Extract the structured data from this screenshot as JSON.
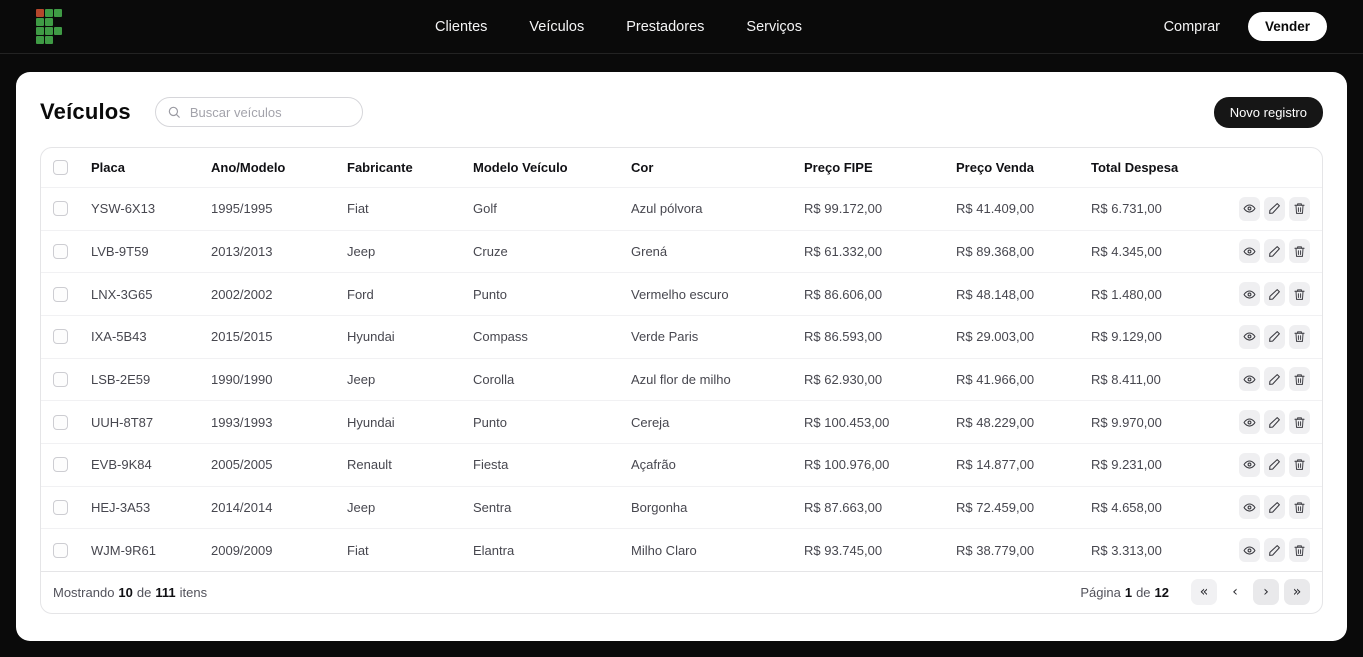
{
  "topbar": {
    "nav": [
      {
        "label": "Clientes"
      },
      {
        "label": "Veículos"
      },
      {
        "label": "Prestadores"
      },
      {
        "label": "Serviços"
      }
    ],
    "comprar_label": "Comprar",
    "vender_label": "Vender"
  },
  "page": {
    "title": "Veículos",
    "search_placeholder": "Buscar veículos",
    "new_record_label": "Novo registro"
  },
  "table": {
    "columns": [
      "Placa",
      "Ano/Modelo",
      "Fabricante",
      "Modelo Veículo",
      "Cor",
      "Preço FIPE",
      "Preço Venda",
      "Total Despesa"
    ],
    "rows": [
      {
        "placa": "YSW-6X13",
        "ano": "1995/1995",
        "fabricante": "Fiat",
        "modelo": "Golf",
        "cor": "Azul pólvora",
        "fipe": "R$ 99.172,00",
        "venda": "R$ 41.409,00",
        "despesa": "R$ 6.731,00"
      },
      {
        "placa": "LVB-9T59",
        "ano": "2013/2013",
        "fabricante": "Jeep",
        "modelo": "Cruze",
        "cor": "Grená",
        "fipe": "R$ 61.332,00",
        "venda": "R$ 89.368,00",
        "despesa": "R$ 4.345,00"
      },
      {
        "placa": "LNX-3G65",
        "ano": "2002/2002",
        "fabricante": "Ford",
        "modelo": "Punto",
        "cor": "Vermelho escuro",
        "fipe": "R$ 86.606,00",
        "venda": "R$ 48.148,00",
        "despesa": "R$ 1.480,00"
      },
      {
        "placa": "IXA-5B43",
        "ano": "2015/2015",
        "fabricante": "Hyundai",
        "modelo": "Compass",
        "cor": "Verde Paris",
        "fipe": "R$ 86.593,00",
        "venda": "R$ 29.003,00",
        "despesa": "R$ 9.129,00"
      },
      {
        "placa": "LSB-2E59",
        "ano": "1990/1990",
        "fabricante": "Jeep",
        "modelo": "Corolla",
        "cor": "Azul flor de milho",
        "fipe": "R$ 62.930,00",
        "venda": "R$ 41.966,00",
        "despesa": "R$ 8.411,00"
      },
      {
        "placa": "UUH-8T87",
        "ano": "1993/1993",
        "fabricante": "Hyundai",
        "modelo": "Punto",
        "cor": "Cereja",
        "fipe": "R$ 100.453,00",
        "venda": "R$ 48.229,00",
        "despesa": "R$ 9.970,00"
      },
      {
        "placa": "EVB-9K84",
        "ano": "2005/2005",
        "fabricante": "Renault",
        "modelo": "Fiesta",
        "cor": "Açafrão",
        "fipe": "R$ 100.976,00",
        "venda": "R$ 14.877,00",
        "despesa": "R$ 9.231,00"
      },
      {
        "placa": "HEJ-3A53",
        "ano": "2014/2014",
        "fabricante": "Jeep",
        "modelo": "Sentra",
        "cor": "Borgonha",
        "fipe": "R$ 87.663,00",
        "venda": "R$ 72.459,00",
        "despesa": "R$ 4.658,00"
      },
      {
        "placa": "WJM-9R61",
        "ano": "2009/2009",
        "fabricante": "Fiat",
        "modelo": "Elantra",
        "cor": "Milho Claro",
        "fipe": "R$ 93.745,00",
        "venda": "R$ 38.779,00",
        "despesa": "R$ 3.313,00"
      }
    ]
  },
  "footer": {
    "showing_prefix": "Mostrando",
    "showing_count": "10",
    "of_word": "de",
    "total_items": "111",
    "items_word": "itens",
    "page_word": "Página",
    "page_current": "1",
    "page_total": "12",
    "pager_first": "«",
    "pager_prev": "‹",
    "pager_next": "›",
    "pager_last": "»"
  },
  "colors": {
    "logo_green": "#3f9b45",
    "logo_red": "#b5472c",
    "topbar_bg": "#0a0a0a",
    "card_bg": "#ffffff",
    "primary_button_bg": "#161616"
  }
}
